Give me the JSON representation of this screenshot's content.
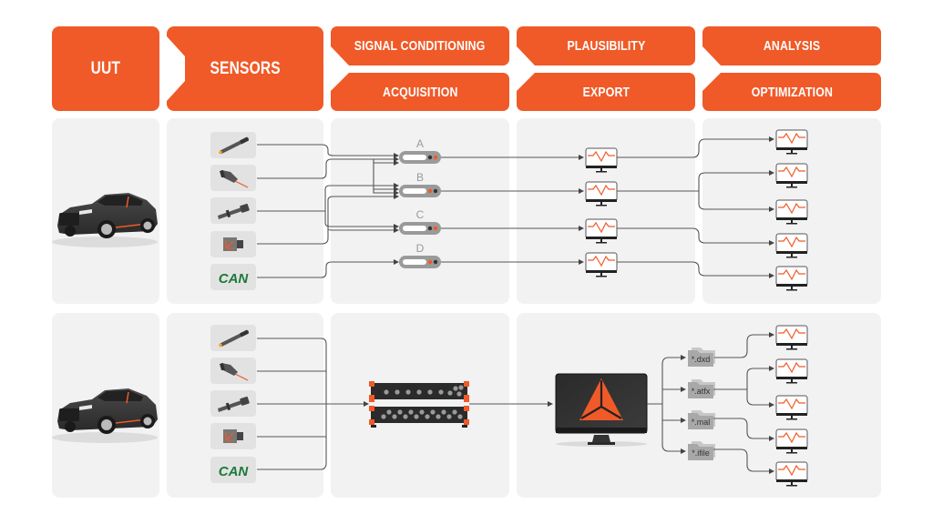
{
  "header": {
    "uut": "UUT",
    "sensors": "SENSORS",
    "signal_conditioning": "SIGNAL CONDITIONING",
    "acquisition": "ACQUISITION",
    "plausibility": "PLAUSIBILITY",
    "export": "EXPORT",
    "analysis": "ANALYSIS",
    "optimization": "OPTIMIZATION"
  },
  "colors": {
    "accent": "#f05a28",
    "panel": "#f2f2f2",
    "line": "#555555",
    "can_green": "#1a7a3a"
  },
  "row1": {
    "sensors": [
      {
        "icon": "pen-sensor-icon"
      },
      {
        "icon": "laser-sensor-icon"
      },
      {
        "icon": "probe-sensor-icon"
      },
      {
        "icon": "accelerometer-icon"
      },
      {
        "icon": "can-bus-icon",
        "label": "CAN"
      }
    ],
    "conditioners": [
      {
        "label": "A"
      },
      {
        "label": "B"
      },
      {
        "label": "C"
      },
      {
        "label": "D"
      }
    ]
  },
  "row2": {
    "sensors": [
      {
        "icon": "pen-sensor-icon"
      },
      {
        "icon": "laser-sensor-icon"
      },
      {
        "icon": "probe-sensor-icon"
      },
      {
        "icon": "accelerometer-icon"
      },
      {
        "icon": "can-bus-icon",
        "label": "CAN"
      }
    ],
    "files": [
      {
        "label": "*.dxd"
      },
      {
        "label": "*.atfx"
      },
      {
        "label": "*.mal"
      },
      {
        "label": "*.ifile"
      }
    ]
  }
}
